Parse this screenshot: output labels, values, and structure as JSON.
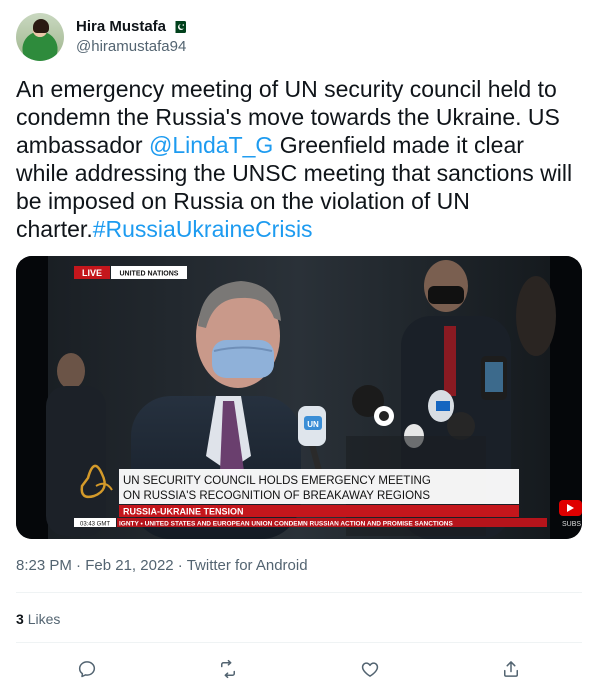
{
  "author": {
    "display_name": "Hira Mustafa",
    "handle": "@hiramustafa94",
    "flag_icon": "pakistan-flag-icon"
  },
  "tweet": {
    "text_part1": "An emergency meeting of UN security council held to condemn the Russia's move towards the Ukraine. US ambassador ",
    "mention": "@LindaT_G",
    "text_part2": "  Greenfield made it clear while addressing the UNSC meeting that sanctions will be imposed on Russia on the violation of UN charter.",
    "hashtag": "#RussiaUkraineCrisis"
  },
  "media": {
    "live_label": "LIVE",
    "location_label": "UNITED NATIONS",
    "headline_line1": "UN SECURITY COUNCIL HOLDS EMERGENCY MEETING",
    "headline_line2": "ON RUSSIA'S RECOGNITION OF BREAKAWAY REGIONS",
    "tension_label": "RUSSIA-UKRAINE TENSION",
    "time_label": "03:43 GMT",
    "ticker_text": "IGNTY  •  UNITED STATES AND EUROPEAN UNION CONDEMN RUSSIAN ACTION AND PROMISE SANCTIONS",
    "subscribe_text": "SUBS",
    "mic_label": "UN"
  },
  "meta": {
    "time": "8:23 PM",
    "date": "Feb 21, 2022",
    "source": "Twitter for Android",
    "separator": " · "
  },
  "stats": {
    "likes_count": "3",
    "likes_label": "Likes"
  },
  "actions": [
    {
      "name": "reply",
      "icon": "reply-icon"
    },
    {
      "name": "retweet",
      "icon": "retweet-icon"
    },
    {
      "name": "like",
      "icon": "heart-icon"
    },
    {
      "name": "share",
      "icon": "share-icon"
    }
  ],
  "colors": {
    "link": "#1d9bf0",
    "secondary_text": "#536471",
    "live_red": "#c4161c"
  }
}
